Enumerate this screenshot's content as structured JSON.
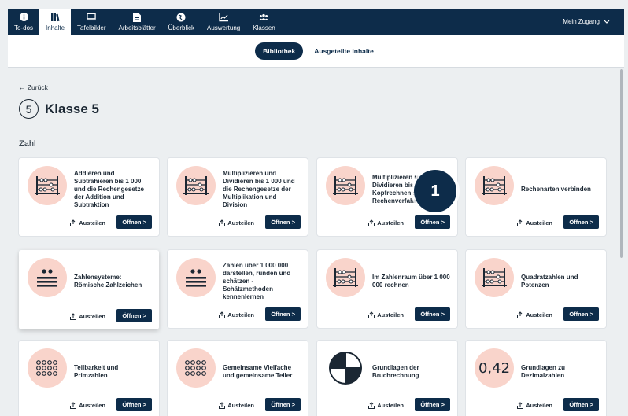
{
  "nav": {
    "items": [
      {
        "label": "To-dos",
        "icon": "info-icon"
      },
      {
        "label": "Inhalte",
        "icon": "books-icon"
      },
      {
        "label": "Tafelbilder",
        "icon": "board-icon"
      },
      {
        "label": "Arbeitsblätter",
        "icon": "document-icon"
      },
      {
        "label": "Überblick",
        "icon": "globe-icon"
      },
      {
        "label": "Auswertung",
        "icon": "chart-icon"
      },
      {
        "label": "Klassen",
        "icon": "group-icon"
      }
    ],
    "account": "Mein Zugang"
  },
  "tabs": {
    "library": "Bibliothek",
    "shared": "Ausgeteilte Inhalte"
  },
  "back": "← Zurück",
  "grade": {
    "number": "5",
    "title": "Klasse 5"
  },
  "section": "Zahl",
  "buttons": {
    "share": "Austeilen",
    "open": "Öffnen"
  },
  "cards": [
    {
      "label": "Addieren und Subtrahieren bis 1 000 und die Rechengesetze der Addition und Subtraktion",
      "icon": "abacus-icon"
    },
    {
      "label": "Multiplizieren und Dividieren bis 1 000 und die Rechengesetze der Multiplikation und Division",
      "icon": "abacus-icon"
    },
    {
      "label": "Multiplizieren und Dividieren bis - Kopfrechnen schriftliches Rechenverfahren",
      "icon": "abacus-icon"
    },
    {
      "label": "Rechenarten verbinden",
      "icon": "abacus-icon"
    },
    {
      "label": "Zahlensysteme: Römische Zahlzeichen",
      "icon": "maya-numeral-icon"
    },
    {
      "label": "Zahlen über 1 000 000 darstellen, runden und schätzen - Schätzmethoden kennenlernen",
      "icon": "maya-numeral-icon"
    },
    {
      "label": "Im Zahlenraum über 1 000 000 rechnen",
      "icon": "abacus-icon"
    },
    {
      "label": "Quadratzahlen und Potenzen",
      "icon": "abacus-icon"
    },
    {
      "label": "Teilbarkeit und Primzahlen",
      "icon": "dot-grid-icon"
    },
    {
      "label": "Gemeinsame Vielfache und gemeinsame Teiler",
      "icon": "dot-grid-icon"
    },
    {
      "label": "Grundlagen der Bruchrechnung",
      "icon": "fraction-pie-icon"
    },
    {
      "label": "Grundlagen zu Dezimalzahlen",
      "icon": "decimal-icon",
      "icon_text": "0,42"
    }
  ],
  "badge": "1"
}
